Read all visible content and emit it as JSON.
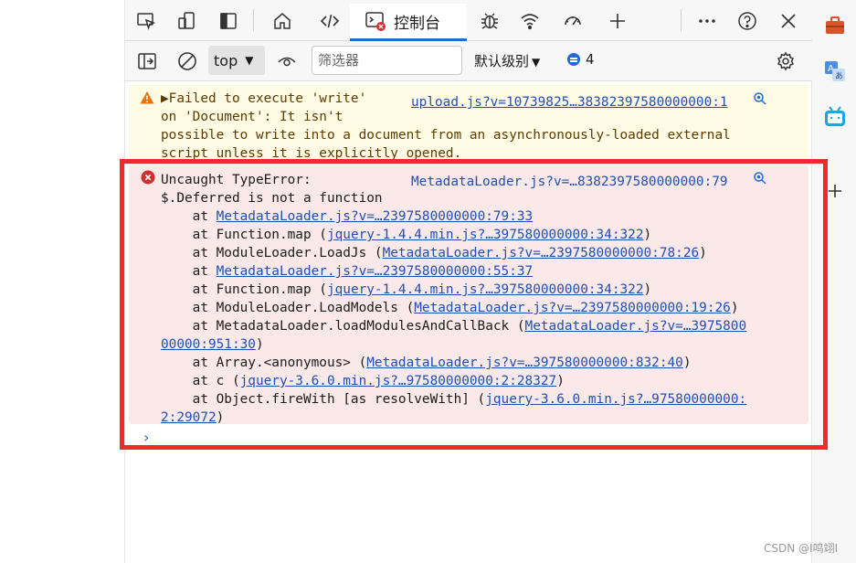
{
  "tabbar": {
    "console_tab_label": "控制台"
  },
  "console_toolbar": {
    "context_label": "top",
    "filter_placeholder": "筛选器",
    "levels_label": "默认级别",
    "issues_count": "4"
  },
  "warning": {
    "text_lines": [
      "▶Failed to execute 'write'",
      "on 'Document': It isn't",
      "possible to write into a document from an asynchronously-loaded external",
      "script unless it is explicitly opened."
    ],
    "source": "upload.js?v=10739825…38382397580000000:1"
  },
  "error": {
    "head_lines": [
      "Uncaught TypeError:",
      "$.Deferred is not a function"
    ],
    "source": "MetadataLoader.js?v=…8382397580000000:79",
    "stack": [
      {
        "prefix": "    at ",
        "link": "MetadataLoader.js?v=…2397580000000:79:33",
        "suffix": ""
      },
      {
        "prefix": "    at Function.map (",
        "link": "jquery-1.4.4.min.js?…397580000000:34:322",
        "suffix": ")"
      },
      {
        "prefix": "    at ModuleLoader.LoadJs (",
        "link": "MetadataLoader.js?v=…2397580000000:78:26",
        "suffix": ")"
      },
      {
        "prefix": "    at ",
        "link": "MetadataLoader.js?v=…2397580000000:55:37",
        "suffix": ""
      },
      {
        "prefix": "    at Function.map (",
        "link": "jquery-1.4.4.min.js?…397580000000:34:322",
        "suffix": ")"
      },
      {
        "prefix": "    at ModuleLoader.LoadModels (",
        "link": "MetadataLoader.js?v=…2397580000000:19:26",
        "suffix": ")"
      },
      {
        "prefix": "    at MetadataLoader.loadModulesAndCallBack (",
        "link": "MetadataLoader.js?v=…3975800",
        "suffix": ""
      },
      {
        "prefix": "",
        "link": "00000:951:30",
        "suffix": ")"
      },
      {
        "prefix": "    at Array.<anonymous> (",
        "link": "MetadataLoader.js?v=…397580000000:832:40",
        "suffix": ")"
      },
      {
        "prefix": "    at c (",
        "link": "jquery-3.6.0.min.js?…97580000000:2:28327",
        "suffix": ")"
      },
      {
        "prefix": "    at Object.fireWith [as resolveWith] (",
        "link": "jquery-3.6.0.min.js?…97580000000:",
        "suffix": ""
      },
      {
        "prefix": "",
        "link": "2:29072",
        "suffix": ")"
      }
    ]
  },
  "prompt_symbol": "›",
  "watermark": "CSDN @I鸣翊I",
  "colors": {
    "highlight_border": "#ee2b2b",
    "accent": "#1f6dd2",
    "error_bg": "#fbe9e9",
    "warning_bg": "#fffbe5"
  }
}
